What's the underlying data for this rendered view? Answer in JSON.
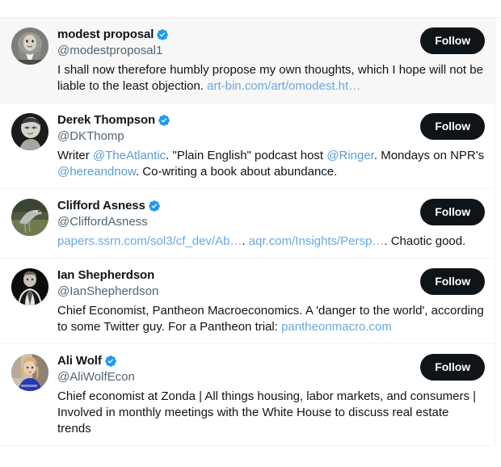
{
  "app": {
    "platform": "twitter-user-list",
    "colors": {
      "accent_blue": "#1d9bf0",
      "link_blue": "#5b9bd5",
      "text_primary": "#0f1419",
      "text_secondary": "#536471",
      "button_bg": "#0f1419",
      "button_text": "#ffffff",
      "row_highlight_bg": "#f7f7f7",
      "separator": "#f2f3f4",
      "page_bg": "#ffffff"
    }
  },
  "follow_button_label": "Follow",
  "users": [
    {
      "display_name": "modest proposal",
      "handle": "@modestproposal1",
      "verified": true,
      "highlighted": true,
      "avatar_name": "avatar-modest-proposal",
      "avatar_alt": "grayscale portrait painting of a man in a periwig",
      "bio_parts": [
        {
          "text": "I shall now therefore humbly propose my own thoughts, which I hope will not be liable to the least objection. ",
          "type": "text"
        },
        {
          "text": "art-bin.com/art/omodest.ht…",
          "type": "url"
        }
      ],
      "follow_label": "Follow"
    },
    {
      "display_name": "Derek Thompson",
      "handle": "@DKThomp",
      "verified": true,
      "highlighted": false,
      "avatar_name": "avatar-derek-thompson",
      "avatar_alt": "black and white photo of a man with glasses",
      "bio_parts": [
        {
          "text": "Writer ",
          "type": "text"
        },
        {
          "text": "@TheAtlantic",
          "type": "mention"
        },
        {
          "text": ". \"Plain English\" podcast host ",
          "type": "text"
        },
        {
          "text": "@Ringer",
          "type": "mention"
        },
        {
          "text": ". Mondays on NPR's ",
          "type": "text"
        },
        {
          "text": "@hereandnow",
          "type": "mention"
        },
        {
          "text": ". Co-writing a book about abundance.",
          "type": "text"
        }
      ],
      "follow_label": "Follow"
    },
    {
      "display_name": "Clifford Asness",
      "handle": "@CliffordAsness",
      "verified": true,
      "highlighted": false,
      "avatar_name": "avatar-clifford-asness",
      "avatar_alt": "photo of a crane bird standing on grass",
      "bio_parts": [
        {
          "text": "papers.ssrn.com/sol3/cf_dev/Ab…",
          "type": "url"
        },
        {
          "text": ". ",
          "type": "text"
        },
        {
          "text": "aqr.com/Insights/Persp…",
          "type": "url"
        },
        {
          "text": ". Chaotic good.",
          "type": "text"
        }
      ],
      "follow_label": "Follow"
    },
    {
      "display_name": "Ian Shepherdson",
      "handle": "@IanShepherdson",
      "verified": false,
      "highlighted": false,
      "avatar_name": "avatar-ian-shepherdson",
      "avatar_alt": "black and white photo of a man in a suit and tie",
      "bio_parts": [
        {
          "text": "Chief Economist, Pantheon Macroeconomics. A 'danger to the world', according to some Twitter guy. For a Pantheon trial: ",
          "type": "text"
        },
        {
          "text": "pantheonmacro.com",
          "type": "url"
        }
      ],
      "follow_label": "Follow"
    },
    {
      "display_name": "Ali Wolf",
      "handle": "@AliWolfEcon",
      "verified": true,
      "highlighted": false,
      "avatar_name": "avatar-ali-wolf",
      "avatar_alt": "photo of a woman with blonde hair wearing a blue top",
      "bio_parts": [
        {
          "text": "Chief economist at Zonda | All things housing, labor markets, and consumers | Involved in monthly meetings with the White House to discuss real estate trends",
          "type": "text"
        }
      ],
      "follow_label": "Follow"
    }
  ]
}
